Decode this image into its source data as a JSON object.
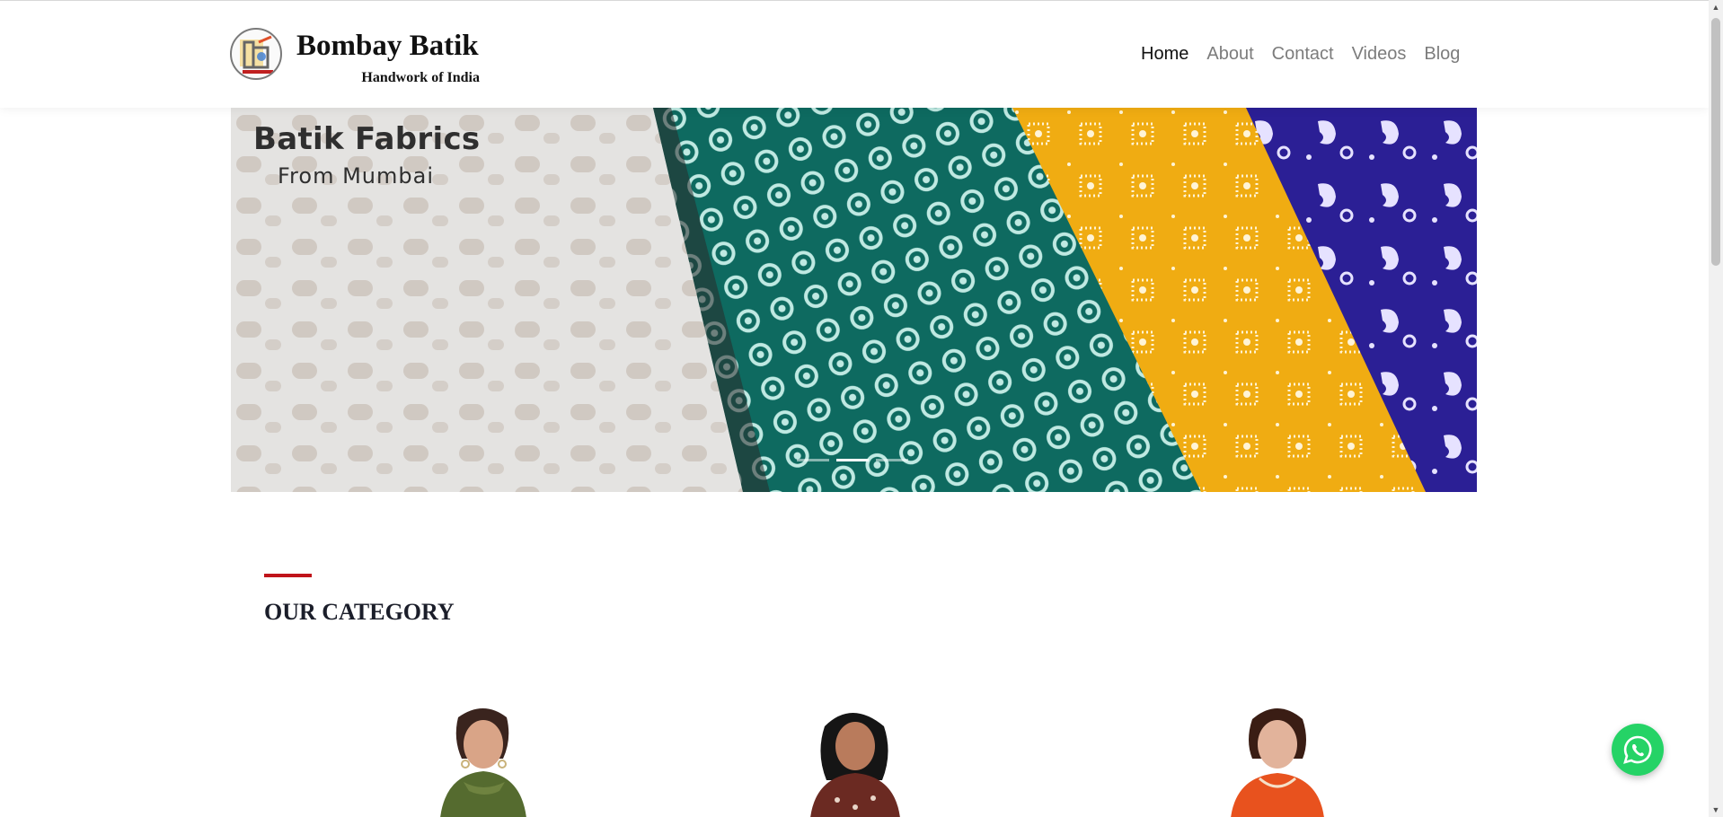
{
  "brand": {
    "title": "Bombay Batik",
    "subtitle": "Handwork of India",
    "logo_icon": "brand-logo-icon"
  },
  "nav": {
    "items": [
      {
        "label": "Home",
        "active": true
      },
      {
        "label": "About",
        "active": false
      },
      {
        "label": "Contact",
        "active": false
      },
      {
        "label": "Videos",
        "active": false
      },
      {
        "label": "Blog",
        "active": false
      }
    ]
  },
  "hero": {
    "title": "Batik Fabrics",
    "subtitle": "From  Mumbai",
    "slides": 3,
    "active_slide": 2
  },
  "category": {
    "heading": "OUR CATEGORY",
    "accent_color": "#c0141a"
  },
  "colors": {
    "teal": "#0e6a60",
    "mustard": "#f0ac12",
    "indigo": "#2b1f95",
    "whatsapp": "#25d366"
  },
  "whatsapp": {
    "icon": "whatsapp-icon"
  }
}
